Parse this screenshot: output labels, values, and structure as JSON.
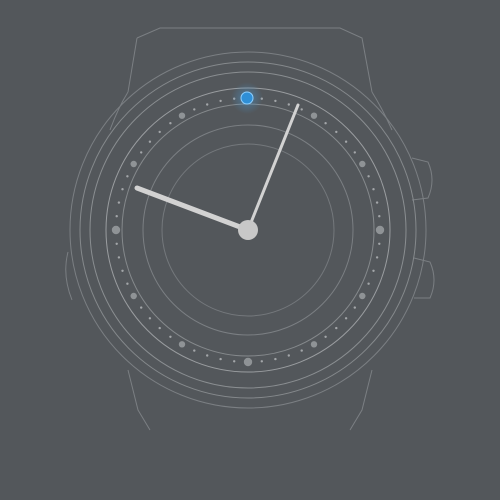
{
  "watch": {
    "time": {
      "hour": 9,
      "minute": 4
    },
    "colors": {
      "background": "#53575b",
      "line": "#9a9da0",
      "line_faint": "#7b7f83",
      "hand": "#d2d2d2",
      "hand_shadow": "#3d4043",
      "dot": "#b4b6b8",
      "indicator": "#2f8fd6",
      "indicator_glow": "#48a6ea"
    },
    "indicator": {
      "position": "12-o-clock",
      "meaning": "selected-marker"
    }
  }
}
